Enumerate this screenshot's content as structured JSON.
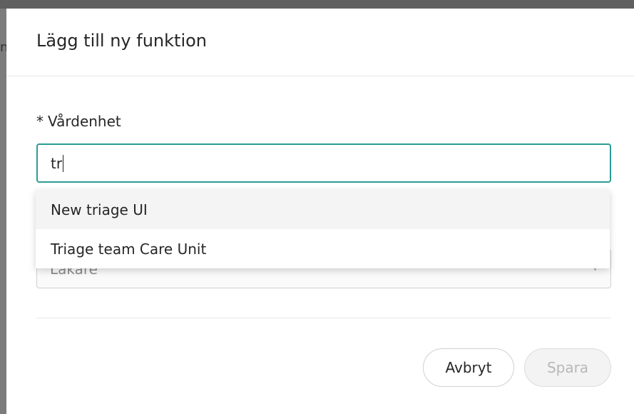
{
  "background": {
    "stub_text": "n"
  },
  "modal": {
    "title": "Lägg till ny funktion",
    "field": {
      "required_mark": "*",
      "label": "Vårdenhet",
      "value": "tr"
    },
    "dropdown": {
      "options": [
        {
          "label": "New triage UI",
          "active": true
        },
        {
          "label": "Triage team Care Unit",
          "active": false
        }
      ]
    },
    "hidden_select": {
      "value": "Läkare"
    },
    "buttons": {
      "cancel": "Avbryt",
      "save": "Spara"
    }
  },
  "colors": {
    "accent": "#2a9d94",
    "overlay": "#5f5f5f"
  }
}
